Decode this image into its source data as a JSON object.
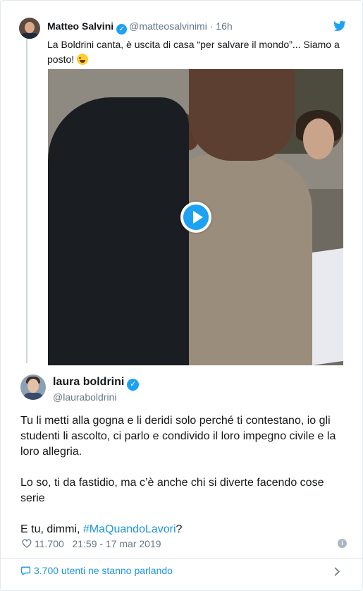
{
  "quoted": {
    "name": "Matteo Salvini",
    "handle": "@matteosalvinimi",
    "separator": "·",
    "time": "16h",
    "text_main": "La Boldrini canta, è uscita di casa “per salvare il mondo”... Siamo a posto! ",
    "emoji_icon": "laughing-tears-emoji"
  },
  "tweet": {
    "name": "laura boldrini",
    "handle": "@lauraboldrini",
    "paragraph1": "Tu li metti alla gogna e li deridi solo perché ti contestano, io gli studenti li ascolto, ci parlo e condivido il loro impegno civile e la loro allegria.",
    "paragraph2": "Lo so, ti da fastidio, ma c’è anche chi si diverte facendo cose serie",
    "paragraph3_prefix": "E tu, dimmi, ",
    "hashtag": "#MaQuandoLavori",
    "paragraph3_suffix": "?",
    "likes": "11.700",
    "timestamp": "21:59 - 17 mar 2019"
  },
  "footer": {
    "conversation": "3.700 utenti ne stanno parlando"
  },
  "colors": {
    "accent": "#1da1f2",
    "link": "#1b95e0",
    "muted": "#657786"
  }
}
